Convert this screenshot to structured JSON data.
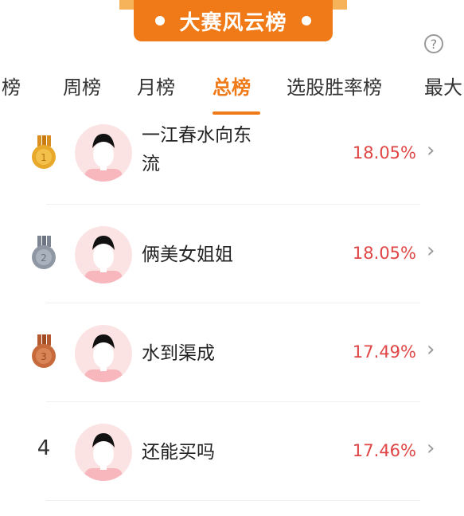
{
  "banner": {
    "title": "大赛风云榜"
  },
  "help_icon": "question-mark-icon",
  "tabs": [
    {
      "label": "日榜",
      "active": false
    },
    {
      "label": "周榜",
      "active": false
    },
    {
      "label": "月榜",
      "active": false
    },
    {
      "label": "总榜",
      "active": true
    },
    {
      "label": "选股胜率榜",
      "active": false
    },
    {
      "label": "最大",
      "active": false
    }
  ],
  "rankings": [
    {
      "rank": "1",
      "medal": "gold-medal-icon",
      "name_line1": "一江春水向东",
      "name_line2": "流",
      "percent": "18.05%"
    },
    {
      "rank": "2",
      "medal": "silver-medal-icon",
      "name_line1": "俩美女姐姐",
      "name_line2": "",
      "percent": "18.05%"
    },
    {
      "rank": "3",
      "medal": "bronze-medal-icon",
      "name_line1": "水到渠成",
      "name_line2": "",
      "percent": "17.49%"
    },
    {
      "rank": "4",
      "medal": "",
      "name_line1": "还能买吗",
      "name_line2": "",
      "percent": "17.46%"
    }
  ],
  "colors": {
    "accent": "#f07a18",
    "percent": "#e04545",
    "gold": "#e8a92b",
    "silver": "#8e97a3",
    "bronze": "#c66a3c"
  }
}
